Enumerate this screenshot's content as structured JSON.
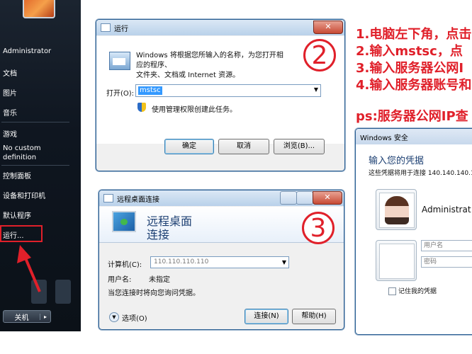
{
  "start_menu": {
    "items": [
      {
        "label": "Administrator"
      },
      {
        "label": "文档"
      },
      {
        "label": "图片"
      },
      {
        "label": "音乐"
      },
      {
        "label": "游戏"
      },
      {
        "label": "No custom"
      },
      {
        "label": "definition"
      },
      {
        "label": "控制面板"
      },
      {
        "label": "设备和打印机"
      },
      {
        "label": "默认程序"
      },
      {
        "label": "运行..."
      }
    ],
    "power_label": "关机",
    "highlight_color": "#e0202a"
  },
  "run_dialog": {
    "title": "运行",
    "description_line1": "Windows 将根据您所输入的名称，为您打开相应的程序、",
    "description_line2": "文件夹、文档或 Internet 资源。",
    "open_label": "打开(O):",
    "open_value": "mstsc",
    "admin_note": "使用管理权限创建此任务。",
    "buttons": {
      "ok": "确定",
      "cancel": "取消",
      "browse": "浏览(B)..."
    },
    "step_number": "2"
  },
  "rdp_dialog": {
    "title": "远程桌面连接",
    "banner_line1": "远程桌面",
    "banner_line2": "连接",
    "computer_label": "计算机(C):",
    "computer_value": "110.110.110.110",
    "username_label": "用户名:",
    "username_value": "未指定",
    "prompt_note": "当您连接时将向您询问凭据。",
    "options_label": "选项(O)",
    "buttons": {
      "connect": "连接(N)",
      "help": "帮助(H)"
    },
    "step_number": "3"
  },
  "security_dialog": {
    "title": "Windows 安全",
    "heading": "输入您的凭据",
    "subtext": "这些凭据将用于连接 140.140.140.1",
    "account_name": "Administrat",
    "username_placeholder": "用户名",
    "password_placeholder": "密码",
    "remember_label": "记住我的凭据"
  },
  "instructions": {
    "line1": "1.电脑左下角，点击",
    "line2": "2.输入mstsc，点",
    "line3": "3.输入服务器公网I",
    "line4": "4.输入服务器账号和",
    "ps": "ps:服务器公网IP查"
  },
  "colors": {
    "accent_red": "#e0202a",
    "win_blue": "#2b5f93"
  }
}
